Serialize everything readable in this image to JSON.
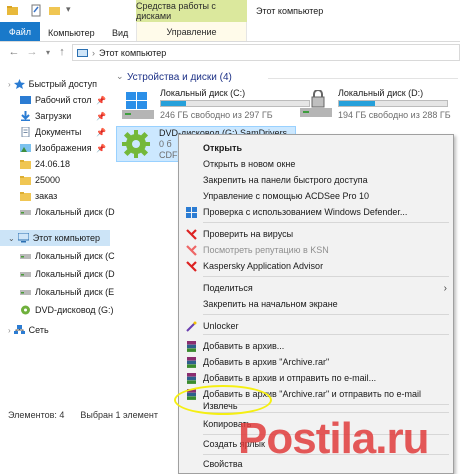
{
  "window": {
    "drives_tools_tab": "Средства работы с дисками",
    "title": "Этот компьютер"
  },
  "ribbon": {
    "tabs": [
      "Файл",
      "Компьютер",
      "Вид",
      "Управление"
    ]
  },
  "address": {
    "path": "Этот компьютер"
  },
  "nav": {
    "items": [
      {
        "label": "Быстрый доступ",
        "icon": "star-icon",
        "pinned": false
      },
      {
        "label": "Рабочий стол",
        "icon": "desktop-icon",
        "pinned": true
      },
      {
        "label": "Загрузки",
        "icon": "download-icon",
        "pinned": true
      },
      {
        "label": "Документы",
        "icon": "documents-icon",
        "pinned": true
      },
      {
        "label": "Изображения",
        "icon": "pictures-icon",
        "pinned": true
      },
      {
        "label": "24.06.18",
        "icon": "folder-icon",
        "pinned": false
      },
      {
        "label": "25000",
        "icon": "folder-icon",
        "pinned": false
      },
      {
        "label": "заказ",
        "icon": "folder-icon",
        "pinned": false
      },
      {
        "label": "Локальный диск (D",
        "icon": "drive-icon",
        "pinned": false
      },
      {
        "label": "Этот компьютер",
        "icon": "computer-icon",
        "pinned": false
      },
      {
        "label": "Локальный диск (C",
        "icon": "drive-icon",
        "pinned": false
      },
      {
        "label": "Локальный диск (D",
        "icon": "drive-icon",
        "pinned": false
      },
      {
        "label": "Локальный диск (E",
        "icon": "drive-icon",
        "pinned": false
      },
      {
        "label": "DVD-дисковод (G:)",
        "icon": "dvd-icon",
        "pinned": false
      },
      {
        "label": "Сеть",
        "icon": "network-icon",
        "pinned": false
      }
    ]
  },
  "main": {
    "section_header": "Устройства и диски (4)",
    "drives": [
      {
        "name": "Локальный диск (C:)",
        "free": "246 ГБ свободно из 297 ГБ",
        "used_fraction": 0.17
      },
      {
        "name": "Локальный диск (D:)",
        "free": "194 ГБ свободно из 288 ГБ",
        "used_fraction": 0.33
      },
      {
        "name": "DVD-дисковод (G:) SamDrivers",
        "line2": "0 б",
        "line3": "CDFS"
      }
    ]
  },
  "status": {
    "items": "Элементов: 4",
    "selected": "Выбран 1 элемент"
  },
  "context_menu": {
    "items": [
      "Открыть",
      "Открыть в новом окне",
      "Закрепить на панели быстрого доступа",
      "Управление с помощью ACDSee Pro 10",
      "Проверка с использованием Windows Defender...",
      "Проверить на вирусы",
      "Посмотреть репутацию в KSN",
      "Kaspersky Application Advisor",
      "Поделиться",
      "Закрепить на начальном экране",
      "Unlocker",
      "Добавить в архив...",
      "Добавить в архив \"Archive.rar\"",
      "Добавить в архив и отправить по e-mail...",
      "Добавить в архив \"Archive.rar\" и отправить по e-mail",
      "Извлечь",
      "Копировать",
      "Создать ярлык",
      "Свойства"
    ]
  },
  "watermark": "Postila.ru",
  "colors": {
    "accent": "#1979ca",
    "drives_tools": "#dbe89d",
    "selection": "#cce8ff",
    "progress": "#26a0da",
    "highlight": "#f5ef12"
  }
}
